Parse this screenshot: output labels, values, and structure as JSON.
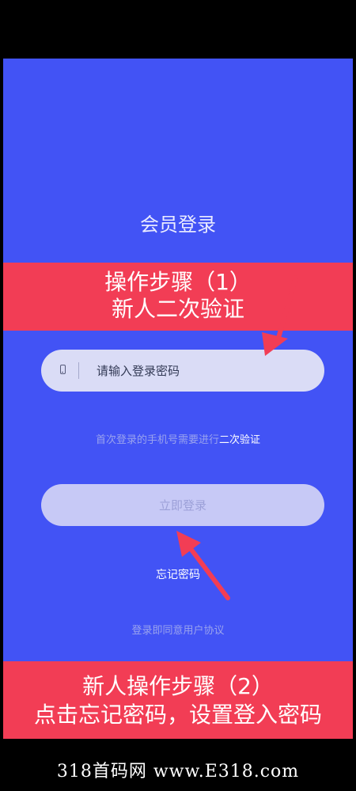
{
  "page": {
    "title": "会员登录"
  },
  "banner1": {
    "line1": "操作步骤（1）",
    "line2": "新人二次验证"
  },
  "password_field": {
    "placeholder": "请输入登录密码",
    "icon": "phone-icon"
  },
  "verify_hint": {
    "text": "首次登录的手机号需要进行",
    "link": "二次验证"
  },
  "login_button": {
    "label": "立即登录"
  },
  "forgot_password": {
    "label": "忘记密码"
  },
  "agreement": {
    "prefix": "登录即同意",
    "link": "用户协议"
  },
  "banner2": {
    "line1": "新人操作步骤（2）",
    "line2": "点击忘记密码，设置登入密码"
  },
  "watermark": {
    "text": "318首码网 www.E318.com"
  },
  "colors": {
    "background": "#4253f5",
    "banner": "#f23d55",
    "arrow": "#f23d55",
    "field": "#dadcf6",
    "button": "#c7c9f6"
  }
}
